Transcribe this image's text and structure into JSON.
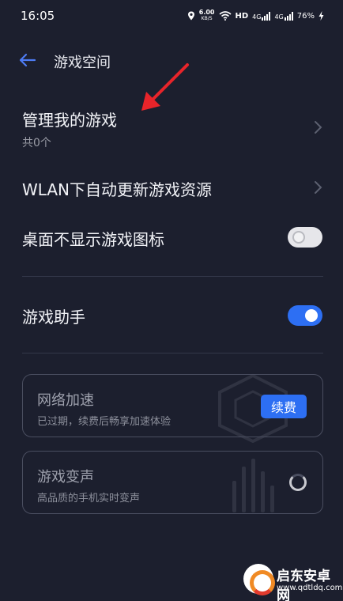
{
  "status_bar": {
    "time": "16:05",
    "net_speed": "6.00",
    "net_unit": "KB/S",
    "hd": "HD",
    "sig1": "4G",
    "sig2": "4G",
    "battery": "76%"
  },
  "header": {
    "title": "游戏空间"
  },
  "rows": {
    "manage": {
      "title": "管理我的游戏",
      "sub": "共0个"
    },
    "wlan": {
      "title": "WLAN下自动更新游戏资源"
    },
    "desktop_icon": {
      "title": "桌面不显示游戏图标",
      "enabled": false
    },
    "assistant": {
      "title": "游戏助手",
      "enabled": true
    }
  },
  "cards": {
    "network": {
      "title": "网络加速",
      "sub": "已过期，续费后畅享加速体验",
      "button": "续费"
    },
    "voice": {
      "title": "游戏变声",
      "sub": "高品质的手机实时变声"
    }
  },
  "watermark": {
    "name": "启东安卓网",
    "url": "www.qdtldq.com"
  },
  "colors": {
    "accent": "#2d6ff3",
    "background": "#1c1f2e",
    "annotation_arrow": "#e8242a"
  }
}
